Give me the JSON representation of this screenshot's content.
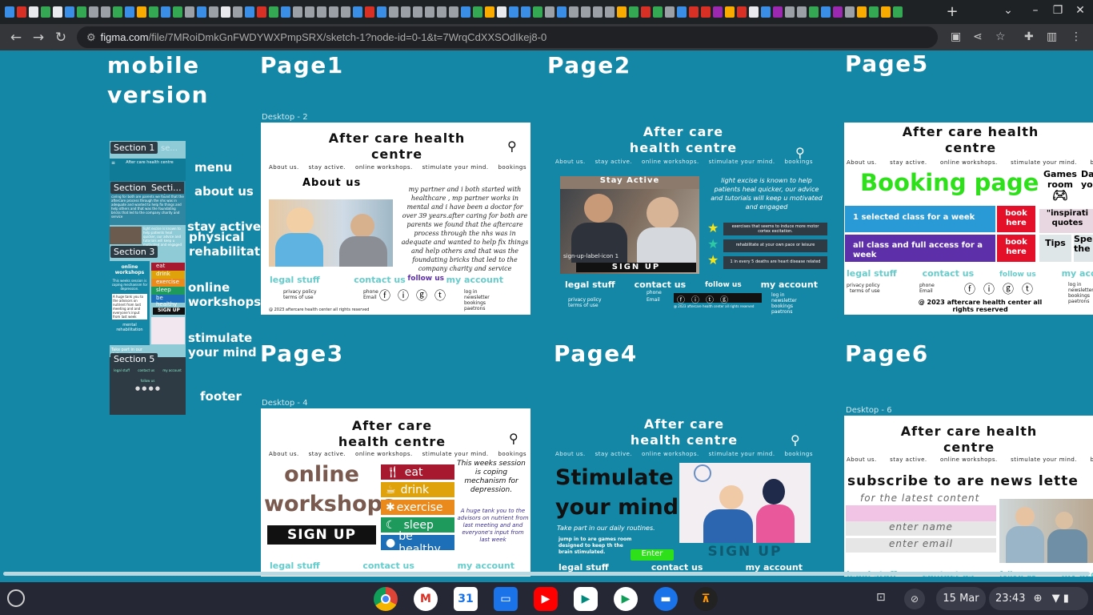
{
  "browser": {
    "url_domain": "figma.com",
    "url_path": "/file/7MRoiDmkGnFWDYWXPmpSRX/sketch-1?node-id=0-1&t=7WrqCdXXSOdIkej8-0"
  },
  "canvas": {
    "mobile": {
      "title_line1": "mobile",
      "title_line2": "version",
      "sections": [
        "Section 1",
        "Section 2",
        "Section 3",
        "Section 5"
      ],
      "sec1_extra": "se...",
      "sec2_extra": "Secti...",
      "labels": {
        "menu": "menu",
        "about": "about us",
        "stay_active": "stay active",
        "physical": "physical",
        "rehab": "rehabilitation",
        "online": "online",
        "workshops": "workshops",
        "stimulate": "stimulate",
        "your_mind": "your mind",
        "footer": "footer"
      },
      "thumb_title": "After care health centre",
      "thumb_about": "About",
      "thumb_bars": [
        "eat",
        "drink",
        "exercise",
        "sleep",
        "be healthy"
      ],
      "thumb_signup": "SIGN UP",
      "thumb_workshops": "online workshops",
      "thumb_mental": "mental rehabilitation",
      "thumb_routines": "Take part in our daily routines.",
      "thumb_footer_links": [
        "legal stuff",
        "contact us",
        "my account"
      ],
      "thumb_follow": "follow us"
    },
    "common": {
      "site_title": "After care health centre",
      "nav": [
        "About us.",
        "stay active.",
        "online workshops.",
        "stimulate your mind.",
        "bookings"
      ],
      "legal": "legal stuff",
      "contact": "contact us",
      "follow": "follow us",
      "account": "my account",
      "privacy": "privacy policy",
      "terms": "terms of use",
      "phone": "phone",
      "email": "Email",
      "login": "log in",
      "newsletter": "newsletter",
      "bookings": "bookings",
      "paetrons": "paetrons",
      "copyright": "@ 2023 aftercare health center all rights reserved"
    },
    "page1": {
      "title": "Page1",
      "frame_label": "Desktop - 2",
      "nav_first": "About us.",
      "about_heading": "About us",
      "about_text": "my partner and i both started with healthcare , mp partner works in mental and i have been a doctor for over 39 years.after caring for both are parents we found that the aftercare process through the nhs was in adequate and wanted to help fix things and help others and that was the foundating bricks that led to the company charity and service",
      "copyright": "@ 2023 aftercare health center all rights reserved"
    },
    "page2": {
      "title": "Page2",
      "stay_active": "Stay Active",
      "photo_caption": "sign-up-label-icon 1",
      "signup": "SIGN UP",
      "intro": "light excise is known to help patients heal quicker, our advice and tutorials will keep u motivated and engaged",
      "facts": [
        "exercises that seems to induce more motor cortex excitation.",
        "rehabilitate at your  own pace or leisure",
        "1 in every 5 deaths are heart disease related"
      ],
      "copyright": "@ 2023 aftercare health center all rights reserved"
    },
    "page5": {
      "title": "Page5",
      "booking": "Booking page",
      "games": "Games room",
      "da": "Da yo",
      "class_week": "1 selected class for a week",
      "book_here": "book here",
      "all_class": "all class and full access for a week",
      "inspiration": "\"inspirati quotes",
      "tips": "Tips",
      "spe": "Spe the",
      "copyright": "@ 2023 aftercare health center all rights reserved"
    },
    "page3": {
      "title": "Page3",
      "frame_label": "Desktop - 4",
      "online": "online",
      "workshops": "workshops",
      "signup": "SIGN UP",
      "bars": [
        "eat",
        "drink",
        "exercise",
        "sleep",
        "be healthy"
      ],
      "session": "This weeks session is coping mechanism for depression.",
      "thanks": "A huge tank you to the advisors on nutrient from last meeting and and everyone's input from last week"
    },
    "page4": {
      "title": "Page4",
      "stimulate": "Stimulate",
      "your_mind": "your mind",
      "routines": "Take part in our daily routines.",
      "games_text": "jump in to are games room designed to keep th the brain stimulated.",
      "enter": "Enter",
      "signup": "SIGN UP"
    },
    "page6": {
      "title": "Page6",
      "frame_label": "Desktop - 6",
      "subscribe": "subscribe to are news lette",
      "latest": "for the latest content",
      "name": "enter name",
      "email": "enter email"
    }
  },
  "taskbar": {
    "date": "15 Mar",
    "time": "23:43"
  },
  "colors": {
    "canvas_bg": "#1487a6",
    "bar_eat": "#a6192e",
    "bar_drink": "#e0a20a",
    "bar_exercise": "#eb8a1c",
    "bar_sleep": "#1e9b5c",
    "bar_healthy": "#1d6fb8",
    "booking_green": "#2ee01a",
    "book_red": "#e4102a",
    "purple": "#5d2fa9"
  }
}
